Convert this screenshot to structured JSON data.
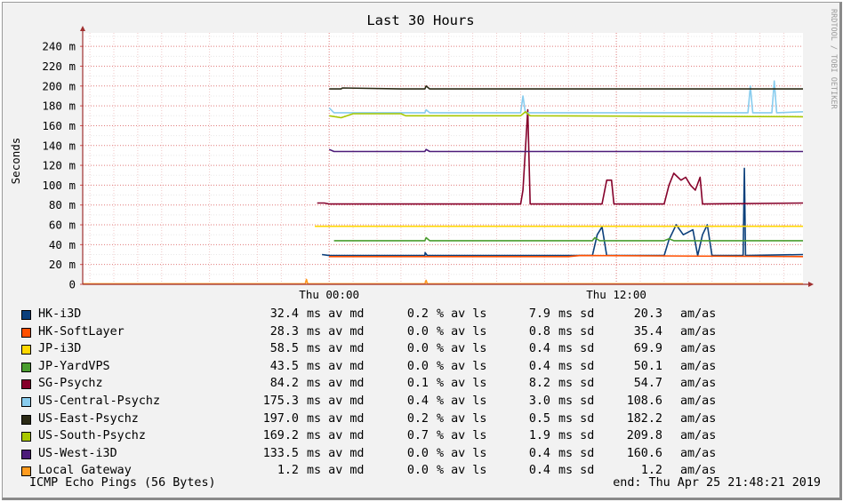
{
  "chart_data": {
    "type": "line",
    "title": "Last 30 Hours",
    "ylabel": "Seconds",
    "watermark": "RRDTOOL / TOBI OETIKER",
    "ylim": [
      0,
      250
    ],
    "y_ticks": [
      "0",
      "20 m",
      "40 m",
      "60 m",
      "80 m",
      "100 m",
      "120 m",
      "140 m",
      "160 m",
      "180 m",
      "200 m",
      "220 m",
      "240 m"
    ],
    "x_ticks": [
      "Thu 00:00",
      "Thu 12:00"
    ],
    "x_range_hours": [
      -10.3,
      19.8
    ],
    "grid": true,
    "series": [
      {
        "name": "HK-i3D",
        "color": "#0b3f7b",
        "avg": "32.4",
        "loss": "0.2",
        "sd": "7.9",
        "amas": "20.3",
        "points": [
          [
            -0.3,
            30
          ],
          [
            0,
            29
          ],
          [
            4,
            29
          ],
          [
            4.01,
            32
          ],
          [
            4.1,
            29
          ],
          [
            11,
            29
          ],
          [
            11.2,
            50
          ],
          [
            11.4,
            58
          ],
          [
            11.6,
            29
          ],
          [
            14,
            29
          ],
          [
            14.2,
            45
          ],
          [
            14.5,
            60
          ],
          [
            14.8,
            50
          ],
          [
            15.2,
            55
          ],
          [
            15.4,
            29
          ],
          [
            15.6,
            50
          ],
          [
            15.8,
            60
          ],
          [
            16.0,
            29
          ],
          [
            17.3,
            29
          ],
          [
            17.35,
            117
          ],
          [
            17.4,
            29
          ],
          [
            19.8,
            30
          ]
        ]
      },
      {
        "name": "HK-SoftLayer",
        "color": "#ff4f00",
        "avg": "28.3",
        "loss": "0.0",
        "sd": "0.8",
        "amas": "35.4",
        "points": [
          [
            0,
            28
          ],
          [
            10,
            28
          ],
          [
            10.5,
            29
          ],
          [
            19.8,
            28
          ]
        ]
      },
      {
        "name": "JP-i3D",
        "color": "#ffd700",
        "avg": "58.5",
        "loss": "0.0",
        "sd": "0.4",
        "amas": "69.9",
        "points": [
          [
            -0.6,
            58.5
          ],
          [
            19.8,
            58.5
          ]
        ]
      },
      {
        "name": "JP-YardVPS",
        "color": "#4a9d2f",
        "avg": "43.5",
        "loss": "0.0",
        "sd": "0.4",
        "amas": "50.1",
        "points": [
          [
            0.2,
            44
          ],
          [
            4,
            44
          ],
          [
            4.05,
            47
          ],
          [
            4.2,
            44
          ],
          [
            11,
            44
          ],
          [
            11.1,
            47
          ],
          [
            11.3,
            44
          ],
          [
            14,
            44
          ],
          [
            14.2,
            46
          ],
          [
            14.4,
            44
          ],
          [
            19.8,
            44
          ]
        ]
      },
      {
        "name": "SG-Psychz",
        "color": "#85002a",
        "avg": "84.2",
        "loss": "0.1",
        "sd": "8.2",
        "amas": "54.7",
        "points": [
          [
            -0.5,
            82
          ],
          [
            -0.2,
            82
          ],
          [
            0,
            81
          ],
          [
            8,
            81
          ],
          [
            8.1,
            95
          ],
          [
            8.3,
            176
          ],
          [
            8.4,
            81
          ],
          [
            11.4,
            81
          ],
          [
            11.6,
            105
          ],
          [
            11.8,
            105
          ],
          [
            11.9,
            81
          ],
          [
            14.0,
            81
          ],
          [
            14.2,
            100
          ],
          [
            14.4,
            112
          ],
          [
            14.7,
            105
          ],
          [
            14.9,
            108
          ],
          [
            15.1,
            100
          ],
          [
            15.3,
            95
          ],
          [
            15.5,
            108
          ],
          [
            15.6,
            81
          ],
          [
            19.8,
            82
          ]
        ]
      },
      {
        "name": "US-Central-Psychz",
        "color": "#88ccee",
        "avg": "175.3",
        "loss": "0.4",
        "sd": "3.0",
        "amas": "108.6",
        "points": [
          [
            0,
            178
          ],
          [
            0.2,
            173
          ],
          [
            4,
            173
          ],
          [
            4.05,
            176
          ],
          [
            4.2,
            173
          ],
          [
            8,
            173
          ],
          [
            8.1,
            190
          ],
          [
            8.2,
            173
          ],
          [
            17.5,
            173
          ],
          [
            17.6,
            200
          ],
          [
            17.7,
            173
          ],
          [
            18.5,
            173
          ],
          [
            18.6,
            205
          ],
          [
            18.7,
            173
          ],
          [
            19.8,
            174
          ]
        ]
      },
      {
        "name": "US-East-Psychz",
        "color": "#2b2a15",
        "avg": "197.0",
        "loss": "0.2",
        "sd": "0.5",
        "amas": "182.2",
        "points": [
          [
            0,
            197
          ],
          [
            0.5,
            197
          ],
          [
            0.55,
            198
          ],
          [
            3,
            197
          ],
          [
            4,
            197
          ],
          [
            4.05,
            200
          ],
          [
            4.2,
            197
          ],
          [
            10,
            197
          ],
          [
            19.8,
            197
          ]
        ]
      },
      {
        "name": "US-South-Psychz",
        "color": "#a8c800",
        "avg": "169.2",
        "loss": "0.7",
        "sd": "1.9",
        "amas": "209.8",
        "points": [
          [
            0,
            170
          ],
          [
            0.5,
            168
          ],
          [
            1,
            172
          ],
          [
            3,
            172
          ],
          [
            3.2,
            170
          ],
          [
            8,
            170
          ],
          [
            8.2,
            174
          ],
          [
            8.4,
            170
          ],
          [
            19.8,
            169
          ]
        ]
      },
      {
        "name": "US-West-i3D",
        "color": "#4c1b79",
        "avg": "133.5",
        "loss": "0.0",
        "sd": "0.4",
        "amas": "160.6",
        "points": [
          [
            0,
            136
          ],
          [
            0.2,
            134
          ],
          [
            4,
            134
          ],
          [
            4.05,
            136
          ],
          [
            4.2,
            134
          ],
          [
            19.8,
            134
          ]
        ]
      },
      {
        "name": "Local Gateway",
        "color": "#ff9b1f",
        "avg": "1.2",
        "loss": "0.0",
        "sd": "0.4",
        "amas": "1.2",
        "points": [
          [
            -10.3,
            0.5
          ],
          [
            -1.0,
            0.5
          ],
          [
            -0.95,
            5
          ],
          [
            -0.9,
            0.5
          ],
          [
            4.0,
            0.5
          ],
          [
            4.05,
            4
          ],
          [
            4.1,
            0.5
          ],
          [
            19.8,
            0.5
          ]
        ]
      }
    ]
  },
  "legend_units": {
    "avg": "ms av md",
    "loss": "% av ls",
    "sd": "ms sd",
    "amas": "am/as"
  },
  "footer": {
    "left": "ICMP Echo Pings (56 Bytes)",
    "right": "end: Thu Apr 25 21:48:21 2019"
  }
}
